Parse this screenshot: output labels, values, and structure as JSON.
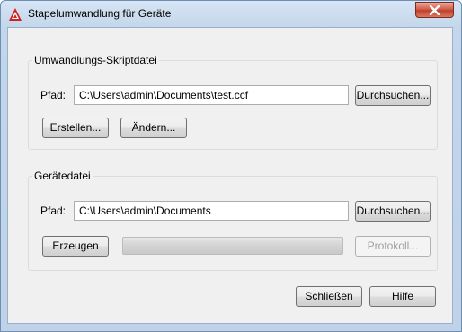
{
  "window": {
    "title": "Stapelumwandlung für Geräte",
    "close_label": "Schließen"
  },
  "script_group": {
    "title": "Umwandlungs-Skriptdatei",
    "path_label": "Pfad:",
    "path_value": "C:\\Users\\admin\\Documents\\test.ccf",
    "browse_label": "Durchsuchen...",
    "create_label": "Erstellen...",
    "modify_label": "Ändern..."
  },
  "device_group": {
    "title": "Gerätedatei",
    "path_label": "Pfad:",
    "path_value": "C:\\Users\\admin\\Documents",
    "browse_label": "Durchsuchen...",
    "generate_label": "Erzeugen",
    "progress": 0,
    "log_label": "Protokoll..."
  },
  "footer": {
    "close_label": "Schließen",
    "help_label": "Hilfe"
  },
  "colors": {
    "app_icon": "#d02020",
    "close_button": "#c1402b"
  },
  "icons": [
    "autocad-logo-icon",
    "close-icon"
  ]
}
